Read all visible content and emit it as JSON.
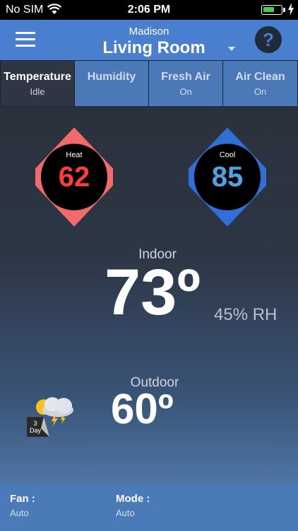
{
  "status_bar": {
    "carrier": "No SIM",
    "time": "2:06 PM",
    "battery_level": 0.7
  },
  "header": {
    "location": "Madison",
    "room": "Living Room",
    "help_label": "?"
  },
  "tabs": [
    {
      "label": "Temperature",
      "status": "Idle",
      "active": true
    },
    {
      "label": "Humidity",
      "status": "",
      "active": false
    },
    {
      "label": "Fresh Air",
      "status": "On",
      "active": false
    },
    {
      "label": "Air Clean",
      "status": "On",
      "active": false
    }
  ],
  "setpoints": {
    "heat": {
      "label": "Heat",
      "value": "62",
      "color": "#ff3b3b",
      "arrow_color": "#f26a6a"
    },
    "cool": {
      "label": "Cool",
      "value": "85",
      "color": "#4aa5e8",
      "arrow_color": "#2f6fd6"
    }
  },
  "indoor": {
    "label": "Indoor",
    "temp": "73º",
    "humidity": "45% RH"
  },
  "outdoor": {
    "label": "Outdoor",
    "temp": "60º",
    "forecast_label": "3 Day",
    "forecast_icon": "partly-cloudy-storm-icon"
  },
  "bottom": {
    "fan": {
      "label": "Fan :",
      "value": "Auto"
    },
    "mode": {
      "label": "Mode :",
      "value": "Auto"
    }
  },
  "colors": {
    "header": "#4a7fd0",
    "tab_inactive": "#4b79b8",
    "tab_active": "#2e3644",
    "bottom_bar": "#4a7ab8"
  }
}
